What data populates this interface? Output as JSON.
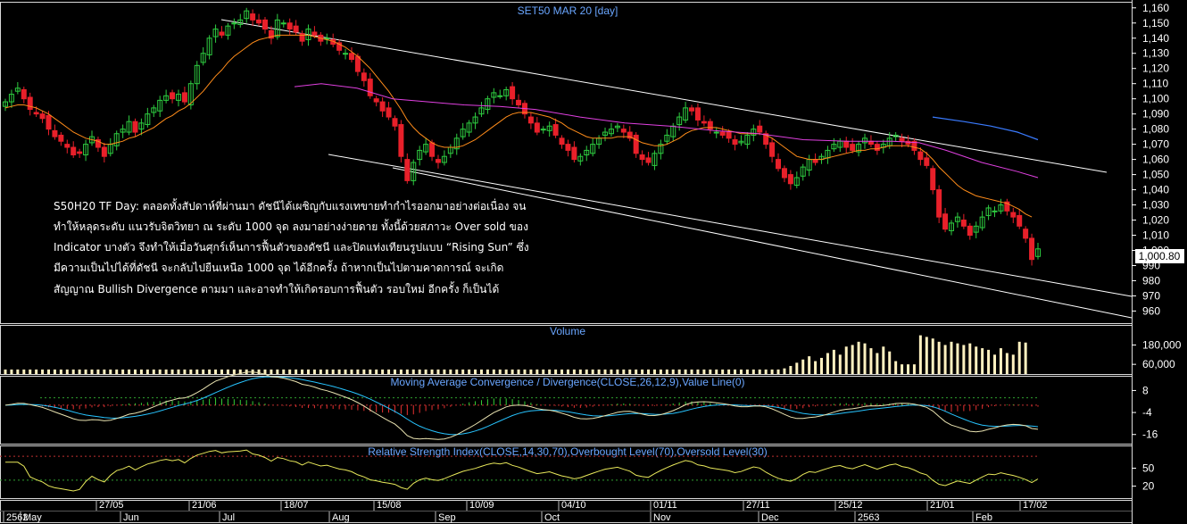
{
  "chart_data": [
    {
      "type": "candlestick",
      "panel": "price",
      "title": "SET50 MAR 20   [day]",
      "yticks": [
        960,
        970,
        980,
        990,
        1000,
        1010,
        1020,
        1030,
        1040,
        1050,
        1060,
        1070,
        1080,
        1090,
        1100,
        1110,
        1120,
        1130,
        1140,
        1150,
        1160
      ],
      "ylim": [
        952,
        1164
      ],
      "last_price": "1,000.80",
      "last_price_value": 1000.8,
      "annotation_lines": [
        "S50H20 TF Day: ตลอดทั้งสัปดาห์ที่ผ่านมา ดัชนีได้เผชิญกับแรงเทขายทำกำไรออกมาอย่างต่อเนื่อง จน",
        "ทำให้หลุดระดับ แนวรับจิตวิทยา ณ ระดับ 1000 จุด ลงมาอย่างง่ายดาย ทั้งนี้ด้วยสภาวะ Over sold ของ",
        "Indicator บางตัว จึงทำให้เมื่อวันศุกร์เห็นการฟื้นตัวของดัชนี และปิดแท่งเทียนรูปแบบ “Rising Sun” ซึ่ง",
        "มีความเป็นไปได้ที่ดัชนี จะกลับไปยืนเหนือ 1000 จุด ได้อีกครั้ง ถ้าหากเป็นไปตามคาดการณ์ จะเกิด",
        "สัญญาณ Bullish Divergence ตามมา และอาจทำให้เกิดรอบการฟื้นตัว รอบใหม่ อีกครั้ง ก็เป็นได้"
      ],
      "closes": [
        1098,
        1103,
        1107,
        1100,
        1093,
        1090,
        1087,
        1080,
        1075,
        1072,
        1068,
        1063,
        1064,
        1070,
        1075,
        1068,
        1062,
        1070,
        1077,
        1080,
        1085,
        1078,
        1084,
        1090,
        1094,
        1099,
        1102,
        1100,
        1103,
        1098,
        1110,
        1122,
        1130,
        1140,
        1146,
        1142,
        1148,
        1150,
        1152,
        1158,
        1152,
        1150,
        1146,
        1140,
        1152,
        1150,
        1146,
        1144,
        1138,
        1146,
        1142,
        1138,
        1140,
        1136,
        1132,
        1130,
        1126,
        1118,
        1112,
        1102,
        1098,
        1092,
        1088,
        1082,
        1062,
        1046,
        1058,
        1066,
        1070,
        1062,
        1058,
        1062,
        1068,
        1074,
        1080,
        1084,
        1088,
        1094,
        1100,
        1104,
        1102,
        1106,
        1100,
        1096,
        1090,
        1084,
        1078,
        1080,
        1082,
        1076,
        1070,
        1066,
        1060,
        1062,
        1066,
        1070,
        1074,
        1078,
        1080,
        1082,
        1078,
        1074,
        1064,
        1060,
        1058,
        1064,
        1070,
        1076,
        1082,
        1088,
        1094,
        1092,
        1086,
        1084,
        1080,
        1078,
        1076,
        1074,
        1070,
        1072,
        1076,
        1080,
        1078,
        1070,
        1062,
        1054,
        1048,
        1044,
        1048,
        1055,
        1060,
        1058,
        1062,
        1066,
        1070,
        1072,
        1068,
        1066,
        1070,
        1074,
        1070,
        1066,
        1070,
        1074,
        1076,
        1072,
        1070,
        1066,
        1060,
        1056,
        1040,
        1022,
        1014,
        1018,
        1022,
        1016,
        1010,
        1016,
        1022,
        1028,
        1026,
        1030,
        1026,
        1022,
        1016,
        1008,
        994,
        1001
      ],
      "sma_short": [
        1094,
        1095,
        1096,
        1096,
        1095,
        1094,
        1092,
        1090,
        1087,
        1084,
        1081,
        1078,
        1076,
        1074,
        1073,
        1072,
        1070,
        1070,
        1071,
        1072,
        1074,
        1075,
        1077,
        1079,
        1081,
        1084,
        1087,
        1089,
        1092,
        1094,
        1097,
        1101,
        1105,
        1110,
        1115,
        1119,
        1124,
        1128,
        1131,
        1134,
        1137,
        1139,
        1140,
        1141,
        1142,
        1142,
        1142,
        1142,
        1142,
        1142,
        1141,
        1140,
        1139,
        1138,
        1136,
        1134,
        1131,
        1128,
        1124,
        1120,
        1115,
        1110,
        1105,
        1099,
        1093,
        1086,
        1081,
        1077,
        1074,
        1071,
        1069,
        1068,
        1068,
        1068,
        1069,
        1071,
        1073,
        1076,
        1079,
        1082,
        1085,
        1088,
        1090,
        1091,
        1091,
        1091,
        1090,
        1089,
        1088,
        1086,
        1084,
        1081,
        1079,
        1077,
        1075,
        1074,
        1074,
        1074,
        1074,
        1075,
        1075,
        1075,
        1073,
        1071,
        1070,
        1069,
        1069,
        1070,
        1072,
        1074,
        1077,
        1079,
        1080,
        1081,
        1081,
        1081,
        1080,
        1079,
        1078,
        1077,
        1077,
        1077,
        1077,
        1076,
        1074,
        1071,
        1068,
        1065,
        1062,
        1061,
        1060,
        1060,
        1060,
        1061,
        1062,
        1063,
        1064,
        1065,
        1066,
        1066,
        1067,
        1067,
        1068,
        1069,
        1069,
        1069,
        1069,
        1068,
        1067,
        1064,
        1060,
        1055,
        1051,
        1047,
        1043,
        1040,
        1038,
        1036,
        1035,
        1034,
        1033,
        1032,
        1031,
        1029,
        1027,
        1024,
        1022
      ],
      "sma_long": [
        null,
        null,
        null,
        null,
        null,
        null,
        null,
        null,
        null,
        null,
        null,
        null,
        null,
        null,
        null,
        null,
        null,
        null,
        null,
        null,
        null,
        null,
        null,
        null,
        null,
        null,
        null,
        null,
        null,
        null,
        null,
        null,
        null,
        null,
        null,
        null,
        null,
        null,
        null,
        null,
        null,
        null,
        null,
        null,
        null,
        null,
        null,
        null,
        null,
        null,
        null,
        null,
        null,
        null,
        null,
        null,
        null,
        null,
        null,
        null,
        null,
        null,
        null,
        null,
        null,
        null,
        null,
        null,
        null,
        null,
        null,
        null,
        null,
        null,
        null,
        null,
        null,
        null,
        null,
        null,
        null,
        null,
        null,
        null,
        null,
        null,
        null,
        null,
        null,
        null,
        null,
        null,
        null,
        null,
        null,
        null,
        null,
        null,
        null,
        null,
        null,
        null,
        null,
        null,
        null,
        null,
        null,
        null,
        null,
        null,
        null,
        null,
        null,
        null,
        null,
        null,
        null,
        null,
        null,
        null,
        null,
        null,
        null,
        null,
        null,
        null,
        null,
        null,
        null,
        null,
        null,
        null,
        null,
        null,
        null,
        null,
        null,
        null,
        null,
        null,
        null,
        null,
        null,
        null,
        null,
        null,
        null,
        null,
        null,
        null,
        null,
        null,
        null,
        null,
        null,
        null,
        null,
        null,
        null,
        null,
        null,
        null,
        null,
        null,
        null,
        null
      ],
      "magenta_line": [
        [
          330,
          1108
        ],
        [
          360,
          1110
        ],
        [
          400,
          1107
        ],
        [
          440,
          1100
        ],
        [
          480,
          1098
        ],
        [
          520,
          1096
        ],
        [
          560,
          1095
        ],
        [
          600,
          1093
        ],
        [
          650,
          1088
        ],
        [
          700,
          1084
        ],
        [
          750,
          1082
        ],
        [
          800,
          1079
        ],
        [
          850,
          1077
        ],
        [
          900,
          1073
        ],
        [
          950,
          1072
        ],
        [
          1000,
          1072
        ],
        [
          1030,
          1071
        ],
        [
          1060,
          1066
        ],
        [
          1100,
          1058
        ],
        [
          1140,
          1052
        ],
        [
          1163,
          1048
        ]
      ],
      "blue_line": [
        [
          1045,
          1088
        ],
        [
          1080,
          1085
        ],
        [
          1110,
          1082
        ],
        [
          1140,
          1078
        ],
        [
          1163,
          1073
        ]
      ]
    },
    {
      "type": "bar",
      "panel": "volume",
      "title": "Volume",
      "yticks": [
        "180,000",
        "60,000"
      ],
      "values": [
        28000,
        28000,
        28000,
        28000,
        28000,
        28000,
        28000,
        28000,
        28000,
        28000,
        28000,
        28000,
        28000,
        28000,
        28000,
        28000,
        28000,
        28000,
        28000,
        28000,
        28000,
        28000,
        28000,
        28000,
        28000,
        28000,
        28000,
        28000,
        28000,
        28000,
        28000,
        28000,
        28000,
        28000,
        28000,
        28000,
        28000,
        28000,
        28000,
        28000,
        28000,
        28000,
        28000,
        28000,
        28000,
        28000,
        28000,
        28000,
        28000,
        28000,
        28000,
        28000,
        28000,
        28000,
        28000,
        28000,
        28000,
        28000,
        28000,
        28000,
        28000,
        28000,
        28000,
        28000,
        28000,
        28000,
        28000,
        28000,
        28000,
        28000,
        28000,
        28000,
        28000,
        28000,
        28000,
        28000,
        28000,
        28000,
        28000,
        28000,
        28000,
        28000,
        28000,
        28000,
        28000,
        28000,
        28000,
        28000,
        28000,
        28000,
        28000,
        28000,
        28000,
        28000,
        28000,
        28000,
        28000,
        28000,
        28000,
        28000,
        28000,
        28000,
        28000,
        28000,
        28000,
        28000,
        28000,
        28000,
        28000,
        28000,
        28000,
        28000,
        28000,
        28000,
        28000,
        28000,
        28000,
        28000,
        28000,
        28000,
        28000,
        28000,
        28000,
        28000,
        28000,
        28000,
        35000,
        50000,
        70000,
        90000,
        110000,
        80000,
        100000,
        130000,
        150000,
        120000,
        170000,
        180000,
        200000,
        190000,
        160000,
        130000,
        170000,
        140000,
        80000,
        60000,
        60000,
        60000,
        240000,
        230000,
        220000,
        200000,
        180000,
        200000,
        190000,
        180000,
        190000,
        170000,
        160000,
        150000,
        120000,
        160000,
        130000,
        120000,
        200000,
        195000
      ]
    },
    {
      "type": "line",
      "panel": "macd",
      "title": "Moving Average Convergence / Divergence(CLOSE,26,12,9),Value Line(0)",
      "yticks": [
        "8",
        "-4",
        "-16"
      ],
      "ylim": [
        -21,
        16
      ]
    },
    {
      "type": "line",
      "panel": "rsi",
      "title": "Relative Strength Index(CLOSE,14,30,70),Overbought Level(70),Oversold Level(30)",
      "yticks": [
        "50",
        "20"
      ],
      "ylim": [
        0,
        88
      ]
    }
  ],
  "xaxis": {
    "row1": [
      "27/05",
      "21/06",
      "18/07",
      "15/08",
      "10/09",
      "04/10",
      "01/11",
      "27/11",
      "25/12",
      "21/01",
      "17/02"
    ],
    "row2": [
      "2562",
      "May",
      "Jun",
      "Jul",
      "Aug",
      "Sep",
      "Oct",
      "Nov",
      "Dec",
      "2563",
      "Feb"
    ]
  },
  "colors": {
    "up": "#2ecc40",
    "down": "#e8202a",
    "sma_short": "#ff8c1a",
    "magenta": "#e040e0",
    "blue": "#3a7bff",
    "trendline": "#ffffff",
    "panel_border": "#ffffff",
    "title": "#6aa6ff",
    "volume_bar": "#fff1c0",
    "rsi_line": "#e8e85a",
    "macd_line": "#e8e2b0",
    "signal_line": "#27c4ff",
    "hist_up": "#35d035",
    "hist_down": "#e83030",
    "price_tag_bg": "#ffffff"
  }
}
